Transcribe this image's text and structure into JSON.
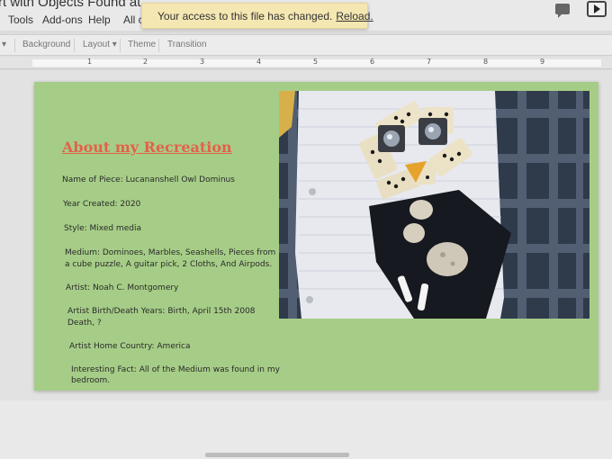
{
  "window": {
    "doc_title": "rt with Objects Found at"
  },
  "menu": {
    "items": [
      "Tools",
      "Add-ons",
      "Help",
      "All c"
    ]
  },
  "notification": {
    "message": "Your access to this file has changed.",
    "action": "Reload."
  },
  "toolbar": {
    "background": "Background",
    "layout": "Layout",
    "theme": "Theme",
    "transition": "Transition"
  },
  "ruler": {
    "marks": [
      "1",
      "2",
      "3",
      "4",
      "5",
      "6",
      "7",
      "8",
      "9"
    ]
  },
  "slide": {
    "title": "About my Recreation",
    "lines": [
      "Name of Piece: Lucananshell Owl Dominus",
      "Year Created: 2020",
      "Style: Mixed media",
      "Medium: Dominoes, Marbles, Seashells, Pieces from",
      "a cube puzzle, A guitar pick, 2 Cloths, And Airpods.",
      "Artist: Noah C. Montgomery",
      "Artist Birth/Death Years: Birth,  April 15th 2008",
      "Death, ?",
      "Artist Home Country: America",
      "Interesting Fact: All of the Medium was found in my",
      "bedroom."
    ]
  },
  "colors": {
    "slide_background": "#a6cd87",
    "title_color": "#e3614a",
    "notice_background": "#f4e7b2"
  },
  "icons": [
    "comment-icon",
    "present-icon",
    "dropdown-arrow-icon"
  ]
}
